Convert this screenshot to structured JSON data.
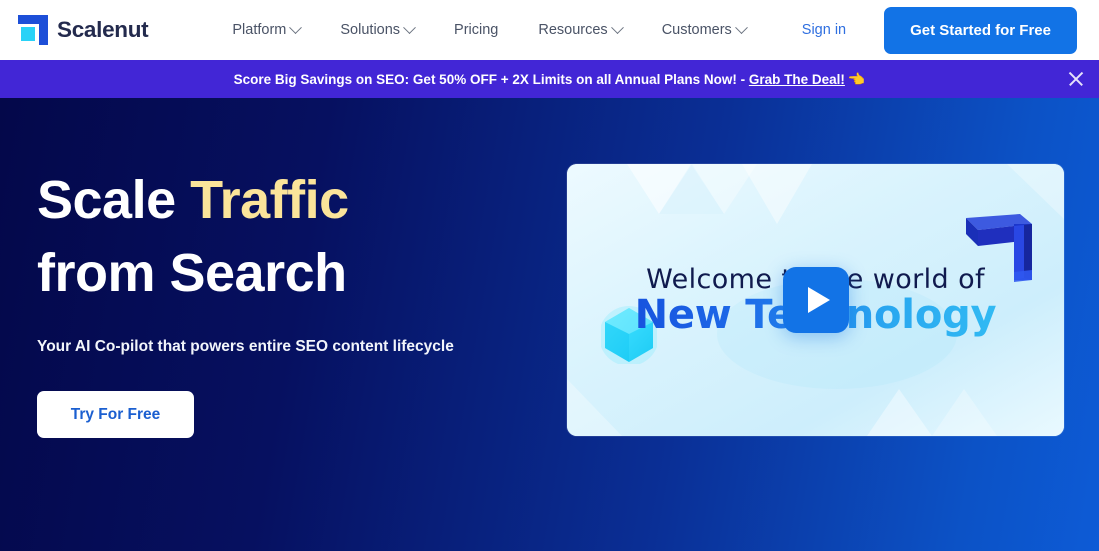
{
  "brand": {
    "name": "Scalenut",
    "logo_colors": {
      "bracket": "#1d4fd8",
      "square": "#29d2f7"
    }
  },
  "nav": {
    "items": [
      {
        "label": "Platform",
        "has_dropdown": true
      },
      {
        "label": "Solutions",
        "has_dropdown": true
      },
      {
        "label": "Pricing",
        "has_dropdown": false
      },
      {
        "label": "Resources",
        "has_dropdown": true
      },
      {
        "label": "Customers",
        "has_dropdown": true
      }
    ],
    "signin_label": "Sign in",
    "cta_label": "Get Started for Free",
    "cta_color": "#1273e6"
  },
  "promo": {
    "text_before": "Score Big Savings on SEO: Get 50% OFF + 2X Limits on all Annual Plans Now! - ",
    "link_label": "Grab The Deal!",
    "emoji": "👈",
    "background": "#4226d6",
    "close_icon": "close-icon"
  },
  "hero": {
    "headline_part1": "Scale ",
    "headline_accent": "Traffic",
    "headline_part2": "from Search",
    "accent_color": "#fbe49a",
    "subheadline": "Your AI Co-pilot that powers entire SEO content lifecycle",
    "cta_label": "Try For Free",
    "background_from": "#04084a",
    "background_to": "#0d5bd6"
  },
  "video": {
    "line1": "Welcome to the world of",
    "line2": "New Technology",
    "play_icon": "play-icon",
    "gem_icon": "hexagon-gem-icon",
    "logo3d_icon": "scalenut-3d-logo-icon",
    "play_button_color": "#1273e6"
  }
}
